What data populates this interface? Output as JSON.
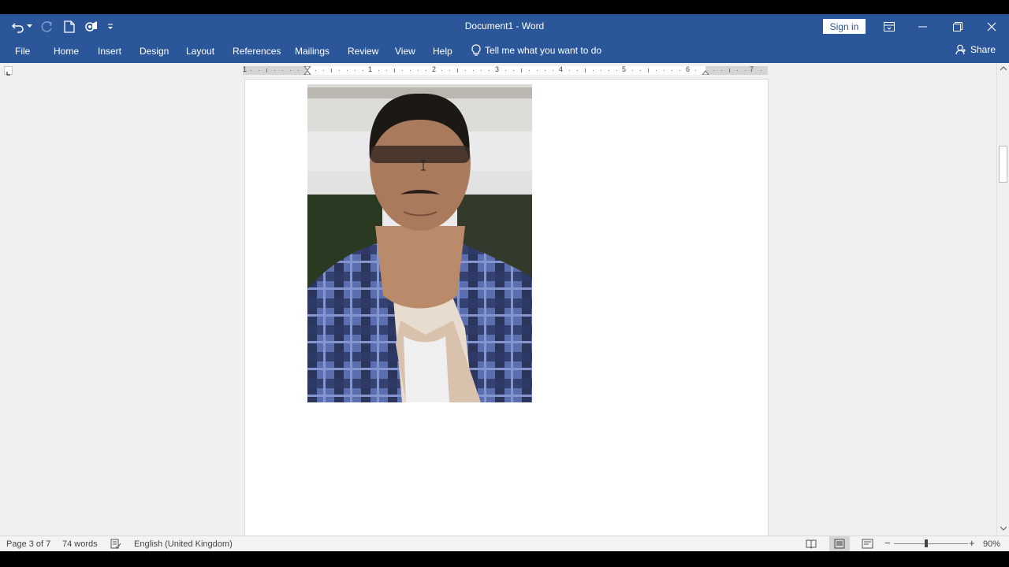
{
  "window": {
    "title": "Document1  -  Word",
    "signin_label": "Sign in"
  },
  "qat": {
    "items": [
      "undo-icon",
      "dropdown-arrow-icon",
      "redo-icon",
      "new-document-icon",
      "touch-mode-icon",
      "customize-qat-icon"
    ]
  },
  "window_controls": [
    "ribbon-display-options-icon",
    "minimize-icon",
    "restore-icon",
    "close-icon"
  ],
  "ribbon": {
    "tabs": [
      {
        "label": "File"
      },
      {
        "label": "Home"
      },
      {
        "label": "Insert"
      },
      {
        "label": "Design"
      },
      {
        "label": "Layout"
      },
      {
        "label": "References"
      },
      {
        "label": "Mailings"
      },
      {
        "label": "Review"
      },
      {
        "label": "View"
      },
      {
        "label": "Help"
      }
    ],
    "tell_me": "Tell me what you want to do",
    "share": "Share"
  },
  "ruler": {
    "numbers": [
      "1",
      "1",
      "2",
      "3",
      "4",
      "5",
      "6",
      "7"
    ]
  },
  "status": {
    "page": "Page 3 of 7",
    "words": "74 words",
    "language": "English (United Kingdom)",
    "zoom": "90%",
    "zoom_level": 0.9
  },
  "colors": {
    "accent": "#2b579a",
    "workspace": "#f0f0f0",
    "statusbar": "#f3f3f3"
  }
}
